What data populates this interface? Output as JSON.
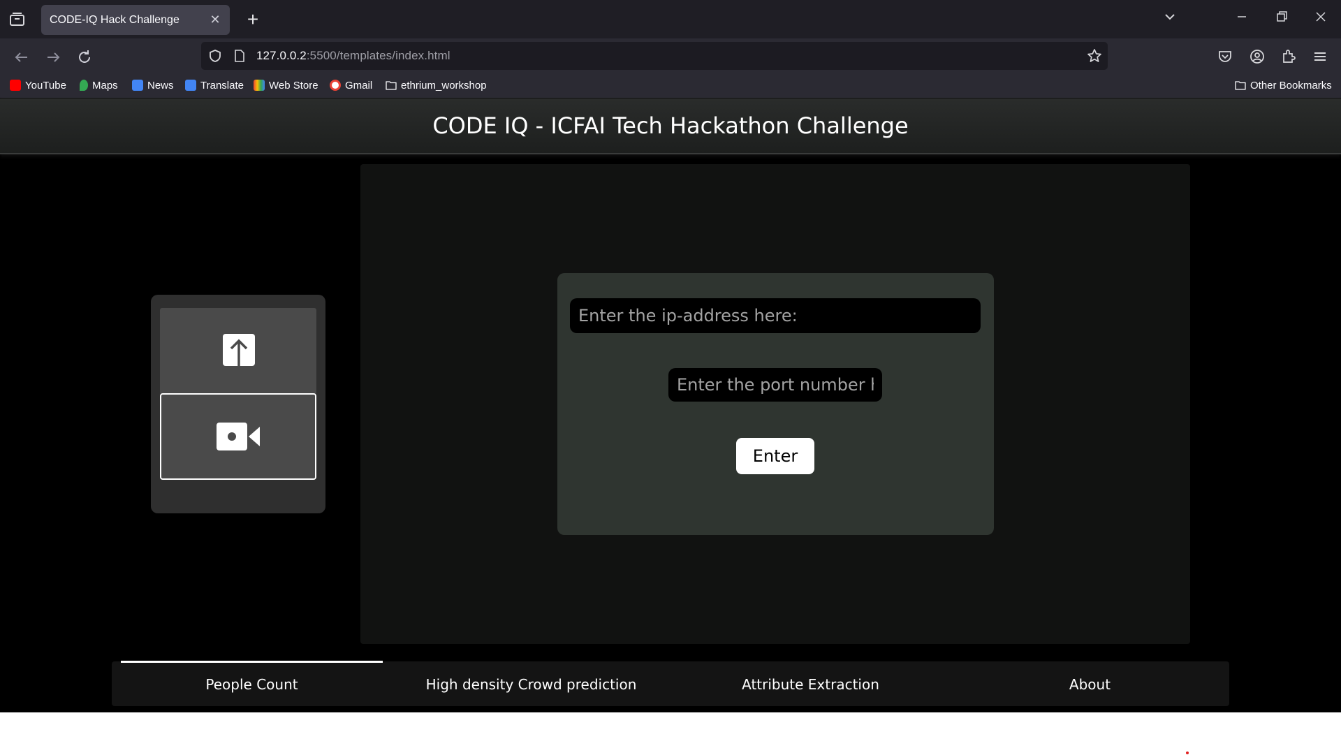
{
  "browser": {
    "tab_title": "CODE-IQ Hack Challenge",
    "url_host": "127.0.0.2",
    "url_rest": ":5500/templates/index.html",
    "bookmarks": [
      {
        "label": "YouTube",
        "color": "#ff0000"
      },
      {
        "label": "Maps",
        "color": "#34a853"
      },
      {
        "label": "News",
        "color": "#4285f4"
      },
      {
        "label": "Translate",
        "color": "#4285f4"
      },
      {
        "label": "Web Store",
        "color": "#ea4335"
      },
      {
        "label": "Gmail",
        "color": "#ea4335"
      },
      {
        "label": "ethrium_workshop",
        "color": ""
      }
    ],
    "other_bookmarks": "Other Bookmarks"
  },
  "page": {
    "title": "CODE IQ - ICFAI Tech Hackathon Challenge",
    "side_buttons": [
      {
        "icon": "upload-icon"
      },
      {
        "icon": "video-camera-icon",
        "selected": true
      }
    ],
    "form": {
      "ip_placeholder": "Enter the ip-address here:",
      "port_placeholder": "Enter the port number here:",
      "enter_label": "Enter"
    },
    "tabs": [
      {
        "label": "People Count",
        "active": true
      },
      {
        "label": "High density Crowd prediction",
        "active": false
      },
      {
        "label": "Attribute Extraction",
        "active": false
      },
      {
        "label": "About",
        "active": false
      }
    ]
  },
  "colors": {
    "page_bg": "#000000",
    "panel_bg": "#111211",
    "form_card_bg": "#2f3530",
    "side_panel_bg": "#2f2f2f"
  }
}
